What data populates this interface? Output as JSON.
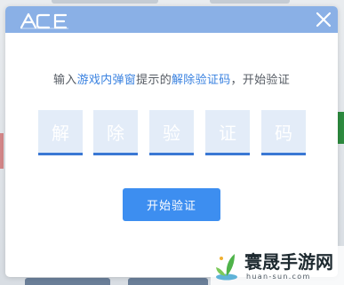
{
  "colors": {
    "header": "#8ab0e6",
    "accent": "#3a82e0",
    "code_box_bg": "#e3ecf8",
    "code_box_underline": "#3a78d4",
    "button": "#3d8ef0"
  },
  "modal": {
    "logo_text": "ACE",
    "logo_icon": "ace-logo",
    "close_icon": "close-icon",
    "instruction": {
      "p1": "输入",
      "link1": "游戏内弹窗",
      "p2": "提示的",
      "link2": "解除验证码",
      "p3": "，开始验证"
    },
    "code_chars": [
      "解",
      "除",
      "验",
      "证",
      "码"
    ],
    "start_button": "开始验证"
  },
  "watermark": {
    "icon": "leaf-logo-icon",
    "title": "寰晟手游网",
    "url": "huan-sun.com"
  }
}
